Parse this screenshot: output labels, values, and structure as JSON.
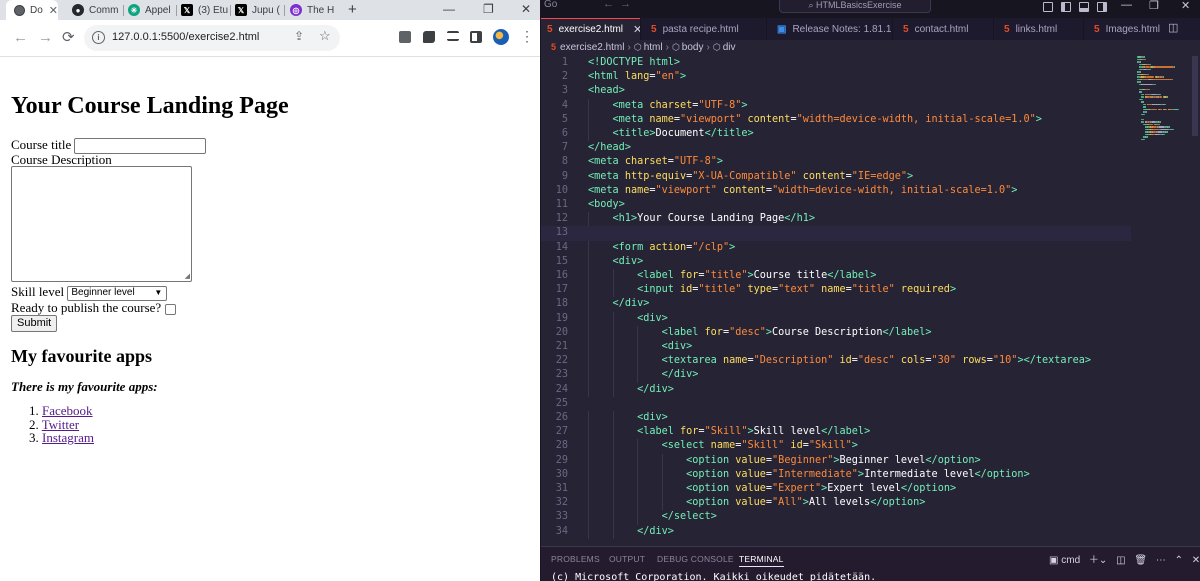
{
  "browser": {
    "tabs": [
      {
        "title": "Do",
        "icon": "chrome-icon",
        "active": true
      },
      {
        "title": "Comm",
        "icon": "github-icon"
      },
      {
        "title": "Appel",
        "icon": "chatgpt-icon"
      },
      {
        "title": "(3) Etu",
        "icon": "x-icon"
      },
      {
        "title": "Jupu (",
        "icon": "x-icon"
      },
      {
        "title": "The H",
        "icon": "tab-purple-icon"
      }
    ],
    "tab_close": "✕",
    "new_tab": "+",
    "window_controls": {
      "minimize": "—",
      "restore": "❐",
      "close": "✕"
    },
    "nav": {
      "back": "←",
      "forward": "→",
      "reload": "⟳"
    },
    "url": "127.0.0.1:5500/exercise2.html"
  },
  "page": {
    "heading": "Your Course Landing Page",
    "course_title_label": "Course title",
    "course_description_label": "Course Description",
    "skill_label": "Skill level",
    "skill_selected": "Beginner level",
    "publish_label": "Ready to publish the course?",
    "submit_label": "Submit",
    "apps_heading": "My favourite apps",
    "apps_subtitle": "There is my favourite apps:",
    "apps": [
      {
        "num": "1.",
        "name": "Facebook"
      },
      {
        "num": "2.",
        "name": "Twitter"
      },
      {
        "num": "3.",
        "name": "Instagram"
      }
    ]
  },
  "vscode": {
    "title_go": "Go",
    "search_text": "HTMLBasicsExercise",
    "tabs": [
      {
        "label": "exercise2.html",
        "active": true,
        "icon_color": "#e34c26"
      },
      {
        "label": "pasta recipe.html",
        "icon_color": "#e34c26"
      },
      {
        "label": "Release Notes: 1.81.1",
        "icon_color": "#3b8eea"
      },
      {
        "label": "contact.html",
        "icon_color": "#e34c26"
      },
      {
        "label": "links.html",
        "icon_color": "#e34c26"
      },
      {
        "label": "Images.html",
        "icon_color": "#e34c26"
      }
    ],
    "breadcrumbs": [
      "exercise2.html",
      "html",
      "body",
      "div"
    ],
    "code_lines": [
      [
        [
          "<!DOCTYPE ",
          "t-b"
        ],
        [
          "html",
          "t-tag"
        ],
        [
          ">",
          "t-b"
        ]
      ],
      [
        [
          "<",
          "t-b"
        ],
        [
          "html",
          "t-tag"
        ],
        [
          " lang",
          "t-attr"
        ],
        [
          "=",
          ""
        ],
        [
          "\"en\"",
          "t-str"
        ],
        [
          ">",
          "t-b"
        ]
      ],
      [
        [
          "<",
          "t-b"
        ],
        [
          "head",
          "t-tag"
        ],
        [
          ">",
          "t-b"
        ]
      ],
      [
        [
          "    <",
          "t-b"
        ],
        [
          "meta",
          "t-tag"
        ],
        [
          " charset",
          "t-attr"
        ],
        [
          "=",
          ""
        ],
        [
          "\"UTF-8\"",
          "t-str"
        ],
        [
          ">",
          "t-b"
        ]
      ],
      [
        [
          "    <",
          "t-b"
        ],
        [
          "meta",
          "t-tag"
        ],
        [
          " name",
          "t-attr"
        ],
        [
          "=",
          ""
        ],
        [
          "\"viewport\"",
          "t-str"
        ],
        [
          " content",
          "t-attr"
        ],
        [
          "=",
          ""
        ],
        [
          "\"width=device-width, initial-scale=1.0\"",
          "t-str"
        ],
        [
          ">",
          "t-b"
        ]
      ],
      [
        [
          "    <",
          "t-b"
        ],
        [
          "title",
          "t-tag"
        ],
        [
          ">",
          "t-b"
        ],
        [
          "Document",
          ""
        ],
        [
          "</",
          "t-b"
        ],
        [
          "title",
          "t-tag"
        ],
        [
          ">",
          "t-b"
        ]
      ],
      [
        [
          "</",
          "t-b"
        ],
        [
          "head",
          "t-tag"
        ],
        [
          ">",
          "t-b"
        ]
      ],
      [
        [
          "<",
          "t-b"
        ],
        [
          "meta",
          "t-tag"
        ],
        [
          " charset",
          "t-attr"
        ],
        [
          "=",
          ""
        ],
        [
          "\"UTF-8\"",
          "t-str"
        ],
        [
          ">",
          "t-b"
        ]
      ],
      [
        [
          "<",
          "t-b"
        ],
        [
          "meta",
          "t-tag"
        ],
        [
          " http-equiv",
          "t-attr"
        ],
        [
          "=",
          ""
        ],
        [
          "\"X-UA-Compatible\"",
          "t-str"
        ],
        [
          " content",
          "t-attr"
        ],
        [
          "=",
          ""
        ],
        [
          "\"IE=edge\"",
          "t-str"
        ],
        [
          ">",
          "t-b"
        ]
      ],
      [
        [
          "<",
          "t-b"
        ],
        [
          "meta",
          "t-tag"
        ],
        [
          " name",
          "t-attr"
        ],
        [
          "=",
          ""
        ],
        [
          "\"viewport\"",
          "t-str"
        ],
        [
          " content",
          "t-attr"
        ],
        [
          "=",
          ""
        ],
        [
          "\"width=device-width, initial-scale=1.0\"",
          "t-str"
        ],
        [
          ">",
          "t-b"
        ]
      ],
      [
        [
          "<",
          "t-b"
        ],
        [
          "body",
          "t-tag"
        ],
        [
          ">",
          "t-b"
        ]
      ],
      [
        [
          "    <",
          "t-b"
        ],
        [
          "h1",
          "t-tag"
        ],
        [
          ">",
          "t-b"
        ],
        [
          "Your Course Landing Page",
          ""
        ],
        [
          "</",
          "t-b"
        ],
        [
          "h1",
          "t-tag"
        ],
        [
          ">",
          "t-b"
        ]
      ],
      [],
      [
        [
          "    <",
          "t-b"
        ],
        [
          "form",
          "t-tag"
        ],
        [
          " action",
          "t-attr"
        ],
        [
          "=",
          ""
        ],
        [
          "\"/clp\"",
          "t-str"
        ],
        [
          ">",
          "t-b"
        ]
      ],
      [
        [
          "    <",
          "t-b"
        ],
        [
          "div",
          "t-tag"
        ],
        [
          ">",
          "t-b"
        ]
      ],
      [
        [
          "        <",
          "t-b"
        ],
        [
          "label",
          "t-tag"
        ],
        [
          " for",
          "t-attr"
        ],
        [
          "=",
          ""
        ],
        [
          "\"title\"",
          "t-str"
        ],
        [
          ">",
          "t-b"
        ],
        [
          "Course title",
          ""
        ],
        [
          "</",
          "t-b"
        ],
        [
          "label",
          "t-tag"
        ],
        [
          ">",
          "t-b"
        ]
      ],
      [
        [
          "        <",
          "t-b"
        ],
        [
          "input",
          "t-tag"
        ],
        [
          " id",
          "t-attr"
        ],
        [
          "=",
          ""
        ],
        [
          "\"title\"",
          "t-str"
        ],
        [
          " type",
          "t-attr"
        ],
        [
          "=",
          ""
        ],
        [
          "\"text\"",
          "t-str"
        ],
        [
          " name",
          "t-attr"
        ],
        [
          "=",
          ""
        ],
        [
          "\"title\"",
          "t-str"
        ],
        [
          " required",
          "t-attr"
        ],
        [
          ">",
          "t-b"
        ]
      ],
      [
        [
          "    </",
          "t-b"
        ],
        [
          "div",
          "t-tag"
        ],
        [
          ">",
          "t-b"
        ]
      ],
      [
        [
          "        <",
          "t-b"
        ],
        [
          "div",
          "t-tag"
        ],
        [
          ">",
          "t-b"
        ]
      ],
      [
        [
          "            <",
          "t-b"
        ],
        [
          "label",
          "t-tag"
        ],
        [
          " for",
          "t-attr"
        ],
        [
          "=",
          ""
        ],
        [
          "\"desc\"",
          "t-str"
        ],
        [
          ">",
          "t-b"
        ],
        [
          "Course Description",
          ""
        ],
        [
          "</",
          "t-b"
        ],
        [
          "label",
          "t-tag"
        ],
        [
          ">",
          "t-b"
        ]
      ],
      [
        [
          "            <",
          "t-b"
        ],
        [
          "div",
          "t-tag"
        ],
        [
          ">",
          "t-b"
        ]
      ],
      [
        [
          "            <",
          "t-b"
        ],
        [
          "textarea",
          "t-tag"
        ],
        [
          " name",
          "t-attr"
        ],
        [
          "=",
          ""
        ],
        [
          "\"Description\"",
          "t-str"
        ],
        [
          " id",
          "t-attr"
        ],
        [
          "=",
          ""
        ],
        [
          "\"desc\"",
          "t-str"
        ],
        [
          " cols",
          "t-attr"
        ],
        [
          "=",
          ""
        ],
        [
          "\"30\"",
          "t-str"
        ],
        [
          " rows",
          "t-attr"
        ],
        [
          "=",
          ""
        ],
        [
          "\"10\"",
          "t-str"
        ],
        [
          "></",
          "t-b"
        ],
        [
          "textarea",
          "t-tag"
        ],
        [
          ">",
          "t-b"
        ]
      ],
      [
        [
          "            </",
          "t-b"
        ],
        [
          "div",
          "t-tag"
        ],
        [
          ">",
          "t-b"
        ]
      ],
      [
        [
          "        </",
          "t-b"
        ],
        [
          "div",
          "t-tag"
        ],
        [
          ">",
          "t-b"
        ]
      ],
      [],
      [
        [
          "        <",
          "t-b"
        ],
        [
          "div",
          "t-tag"
        ],
        [
          ">",
          "t-b"
        ]
      ],
      [
        [
          "        <",
          "t-b"
        ],
        [
          "label",
          "t-tag"
        ],
        [
          " for",
          "t-attr"
        ],
        [
          "=",
          ""
        ],
        [
          "\"Skill\"",
          "t-str"
        ],
        [
          ">",
          "t-b"
        ],
        [
          "Skill level",
          ""
        ],
        [
          "</",
          "t-b"
        ],
        [
          "label",
          "t-tag"
        ],
        [
          ">",
          "t-b"
        ]
      ],
      [
        [
          "            <",
          "t-b"
        ],
        [
          "select",
          "t-tag"
        ],
        [
          " name",
          "t-attr"
        ],
        [
          "=",
          ""
        ],
        [
          "\"Skill\"",
          "t-str"
        ],
        [
          " id",
          "t-attr"
        ],
        [
          "=",
          ""
        ],
        [
          "\"Skill\"",
          "t-str"
        ],
        [
          ">",
          "t-b"
        ]
      ],
      [
        [
          "                <",
          "t-b"
        ],
        [
          "option",
          "t-tag"
        ],
        [
          " value",
          "t-attr"
        ],
        [
          "=",
          ""
        ],
        [
          "\"Beginner\"",
          "t-str"
        ],
        [
          ">",
          "t-b"
        ],
        [
          "Beginner level",
          ""
        ],
        [
          "</",
          "t-b"
        ],
        [
          "option",
          "t-tag"
        ],
        [
          ">",
          "t-b"
        ]
      ],
      [
        [
          "                <",
          "t-b"
        ],
        [
          "option",
          "t-tag"
        ],
        [
          " value",
          "t-attr"
        ],
        [
          "=",
          ""
        ],
        [
          "\"Intermediate\"",
          "t-str"
        ],
        [
          ">",
          "t-b"
        ],
        [
          "Intermediate level",
          ""
        ],
        [
          "</",
          "t-b"
        ],
        [
          "option",
          "t-tag"
        ],
        [
          ">",
          "t-b"
        ]
      ],
      [
        [
          "                <",
          "t-b"
        ],
        [
          "option",
          "t-tag"
        ],
        [
          " value",
          "t-attr"
        ],
        [
          "=",
          ""
        ],
        [
          "\"Expert\"",
          "t-str"
        ],
        [
          ">",
          "t-b"
        ],
        [
          "Expert level",
          ""
        ],
        [
          "</",
          "t-b"
        ],
        [
          "option",
          "t-tag"
        ],
        [
          ">",
          "t-b"
        ]
      ],
      [
        [
          "                <",
          "t-b"
        ],
        [
          "option",
          "t-tag"
        ],
        [
          " value",
          "t-attr"
        ],
        [
          "=",
          ""
        ],
        [
          "\"All\"",
          "t-str"
        ],
        [
          ">",
          "t-b"
        ],
        [
          "All levels",
          ""
        ],
        [
          "</",
          "t-b"
        ],
        [
          "option",
          "t-tag"
        ],
        [
          ">",
          "t-b"
        ]
      ],
      [
        [
          "            </",
          "t-b"
        ],
        [
          "select",
          "t-tag"
        ],
        [
          ">",
          "t-b"
        ]
      ],
      [
        [
          "        </",
          "t-b"
        ],
        [
          "div",
          "t-tag"
        ],
        [
          ">",
          "t-b"
        ]
      ]
    ],
    "panel_tabs": [
      "PROBLEMS",
      "OUTPUT",
      "DEBUG CONSOLE",
      "TERMINAL"
    ],
    "terminal_name": "cmd",
    "terminal_text": "(c) Microsoft Corporation. Kaikki oikeudet pidätetään."
  },
  "colors": {
    "accent": "#fe4450",
    "tag": "#72f1b8",
    "attr": "#fede5d",
    "string": "#ff8b39",
    "editor_bg": "#262335",
    "link": "#551a8b"
  }
}
